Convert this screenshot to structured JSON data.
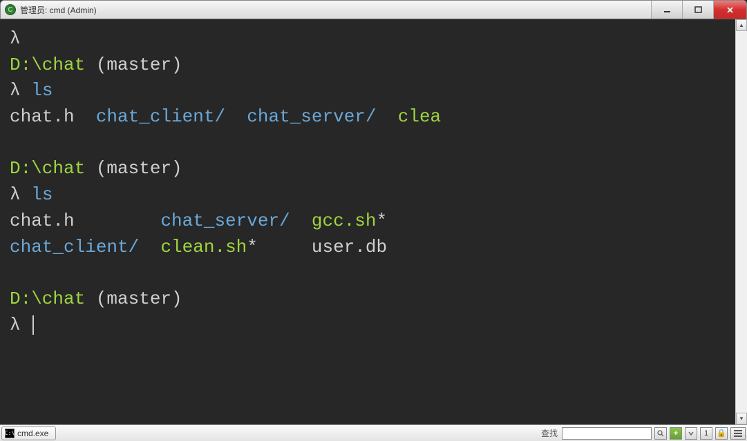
{
  "titlebar": {
    "icon_text": "C",
    "title": "管理员: cmd (Admin)"
  },
  "terminal": {
    "lines": [
      {
        "segments": [
          {
            "cls": "lambda",
            "text": "λ"
          }
        ]
      },
      {
        "segments": [
          {
            "cls": "path",
            "text": "D:\\chat "
          },
          {
            "cls": "branch",
            "text": "(master)"
          }
        ]
      },
      {
        "segments": [
          {
            "cls": "lambda",
            "text": "λ "
          },
          {
            "cls": "cmd",
            "text": "ls"
          }
        ]
      },
      {
        "segments": [
          {
            "cls": "file-plain",
            "text": "chat.h  "
          },
          {
            "cls": "dir",
            "text": "chat_client/"
          },
          {
            "cls": "file-plain",
            "text": "  "
          },
          {
            "cls": "dir",
            "text": "chat_server/"
          },
          {
            "cls": "file-plain",
            "text": "  "
          },
          {
            "cls": "exec",
            "text": "clea"
          }
        ]
      },
      {
        "segments": [
          {
            "cls": "file-plain",
            "text": " "
          }
        ]
      },
      {
        "segments": [
          {
            "cls": "path",
            "text": "D:\\chat "
          },
          {
            "cls": "branch",
            "text": "(master)"
          }
        ]
      },
      {
        "segments": [
          {
            "cls": "lambda",
            "text": "λ "
          },
          {
            "cls": "cmd",
            "text": "ls"
          }
        ]
      },
      {
        "segments": [
          {
            "cls": "file-plain",
            "text": "chat.h        "
          },
          {
            "cls": "dir",
            "text": "chat_server/"
          },
          {
            "cls": "file-plain",
            "text": "  "
          },
          {
            "cls": "exec",
            "text": "gcc.sh"
          },
          {
            "cls": "file-plain",
            "text": "*"
          }
        ]
      },
      {
        "segments": [
          {
            "cls": "dir",
            "text": "chat_client/"
          },
          {
            "cls": "file-plain",
            "text": "  "
          },
          {
            "cls": "exec",
            "text": "clean.sh"
          },
          {
            "cls": "file-plain",
            "text": "*     user.db"
          }
        ]
      },
      {
        "segments": [
          {
            "cls": "file-plain",
            "text": " "
          }
        ]
      },
      {
        "segments": [
          {
            "cls": "path",
            "text": "D:\\chat "
          },
          {
            "cls": "branch",
            "text": "(master)"
          }
        ]
      },
      {
        "segments": [
          {
            "cls": "lambda",
            "text": "λ "
          }
        ],
        "cursor": true
      }
    ]
  },
  "statusbar": {
    "tab_label": "cmd.exe",
    "search_label": "查找",
    "add_label": "+",
    "lock_label": "🔒",
    "num_label": "1"
  }
}
